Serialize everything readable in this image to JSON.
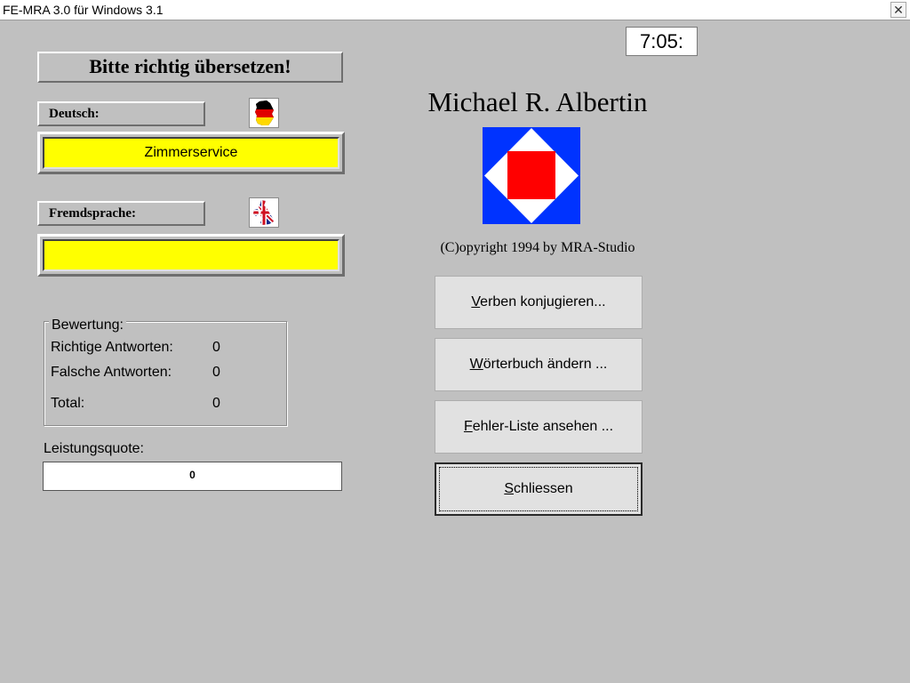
{
  "window": {
    "title": "FE-MRA 3.0 für Windows 3.1",
    "close_glyph": "✕"
  },
  "clock": "7:05:",
  "heading": "Bitte richtig übersetzen!",
  "deutsch": {
    "label": "Deutsch:",
    "value": "Zimmerservice",
    "flag_icon": "german-flag-map-icon"
  },
  "fremdsprache": {
    "label": "Fremdsprache:",
    "value": "",
    "flag_icon": "uk-flag-map-icon"
  },
  "bewertung": {
    "title": "Bewertung:",
    "rows": [
      {
        "label": "Richtige Antworten:",
        "value": "0"
      },
      {
        "label": "Falsche Antworten:",
        "value": "0"
      },
      {
        "label": "Total:",
        "value": "0"
      }
    ]
  },
  "leistungsquote": {
    "label": "Leistungsquote:",
    "value": "0"
  },
  "author": "Michael R. Albertin",
  "copyright": "(C)opyright 1994 by MRA-Studio",
  "buttons": {
    "verben": {
      "accel": "V",
      "rest": "erben konjugieren..."
    },
    "woerterbuch": {
      "accel": "W",
      "rest": "örterbuch ändern ..."
    },
    "fehler": {
      "accel": "F",
      "rest": "ehler-Liste ansehen ..."
    },
    "schliessen": {
      "accel": "S",
      "rest": "chliessen"
    }
  },
  "colors": {
    "background": "#c0c0c0",
    "field": "#ffff00",
    "logo_blue": "#0033ff",
    "logo_red": "#ff0000"
  }
}
